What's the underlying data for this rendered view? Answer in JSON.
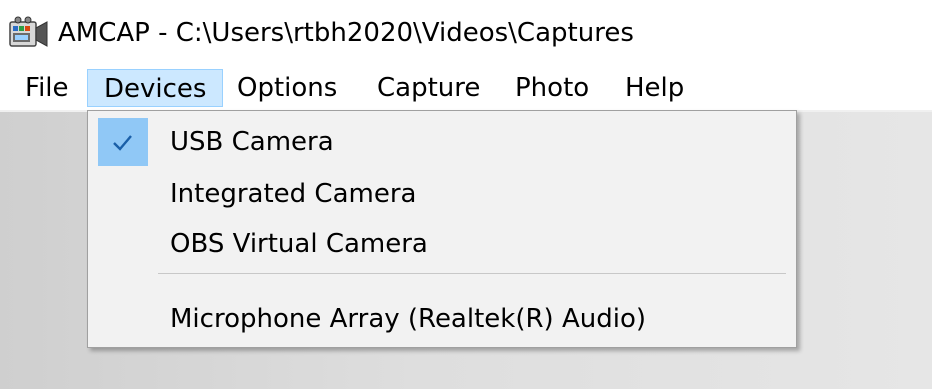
{
  "window": {
    "title": "AMCAP - C:\\Users\\rtbh2020\\Videos\\Captures",
    "icon": "camera-app-icon"
  },
  "menubar": {
    "items": [
      {
        "label": "File",
        "active": false
      },
      {
        "label": "Devices",
        "active": true
      },
      {
        "label": "Options",
        "active": false
      },
      {
        "label": "Capture",
        "active": false
      },
      {
        "label": "Photo",
        "active": false
      },
      {
        "label": "Help",
        "active": false
      }
    ]
  },
  "devices_menu": {
    "items": [
      {
        "label": "USB Camera",
        "checked": true
      },
      {
        "label": "Integrated Camera",
        "checked": false
      },
      {
        "label": "OBS Virtual Camera",
        "checked": false
      },
      {
        "label": "Microphone Array (Realtek(R) Audio)",
        "checked": false
      }
    ],
    "check_icon": "checkmark-icon"
  },
  "colors": {
    "menu_highlight": "#cce8ff",
    "menu_highlight_border": "#99d1ff",
    "check_background": "#90c8f6",
    "check_mark": "#1a5fa8"
  }
}
